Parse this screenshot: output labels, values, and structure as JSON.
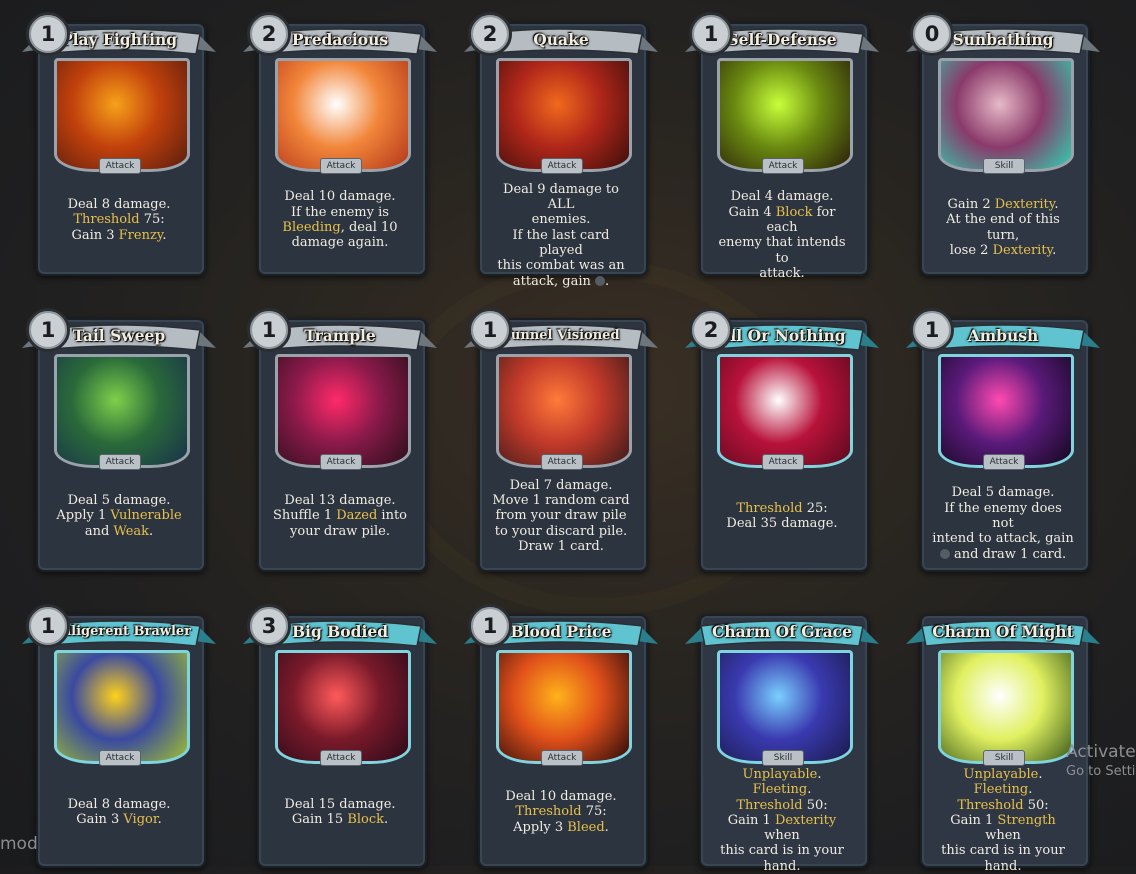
{
  "cards": [
    {
      "cost": "1",
      "title": "Play Fighting",
      "type": "Attack",
      "style": "grey",
      "lines": [
        [
          "Deal 8 damage."
        ],
        [
          {
            "k": "Threshold"
          },
          " 75:"
        ],
        [
          "Gain 3 ",
          {
            "k": "Frenzy"
          },
          "."
        ]
      ],
      "art": [
        "#f7a11a",
        "#c2410c",
        "#5a1d0e"
      ]
    },
    {
      "cost": "2",
      "title": "Predacious",
      "type": "Attack",
      "style": "grey",
      "lines": [
        [
          "Deal 10 damage."
        ],
        [
          "If the enemy is"
        ],
        [
          {
            "k": "Bleeding"
          },
          ", deal 10"
        ],
        [
          "damage again."
        ]
      ],
      "art": [
        "#ffffff",
        "#f2863a",
        "#b3361a"
      ]
    },
    {
      "cost": "2",
      "title": "Quake",
      "type": "Attack",
      "style": "grey",
      "lines": [
        [
          "Deal 9 damage to ALL"
        ],
        [
          "enemies."
        ],
        [
          "If the last card played"
        ],
        [
          "this combat was an"
        ],
        [
          "attack, gain ",
          {
            "orb": true
          },
          "."
        ]
      ],
      "art": [
        "#f06a1c",
        "#b0261a",
        "#3a0f0a"
      ]
    },
    {
      "cost": "1",
      "title": "Self-Defense",
      "type": "Attack",
      "style": "grey",
      "lines": [
        [
          "Deal 4 damage."
        ],
        [
          "Gain 4 ",
          {
            "k": "Block"
          },
          " for each"
        ],
        [
          "enemy that intends to"
        ],
        [
          "attack."
        ]
      ],
      "art": [
        "#c8ff3a",
        "#6a8a10",
        "#2a1d0a"
      ]
    },
    {
      "cost": "0",
      "title": "Sunbathing",
      "type": "Skill",
      "style": "grey",
      "lines": [
        [
          "Gain 2 ",
          {
            "k": "Dexterity"
          },
          "."
        ],
        [
          "At the end of this turn,"
        ],
        [
          "lose 2 ",
          {
            "k": "Dexterity"
          },
          "."
        ]
      ],
      "art": [
        "#e7b9c8",
        "#8a3a6a",
        "#2fd1b0"
      ]
    },
    {
      "cost": "1",
      "title": "Tail Sweep",
      "type": "Attack",
      "style": "grey",
      "lines": [
        [
          "Deal 5 damage."
        ],
        [
          "Apply 1 ",
          {
            "k": "Vulnerable"
          }
        ],
        [
          "and ",
          {
            "k": "Weak"
          },
          "."
        ]
      ],
      "art": [
        "#7fd04a",
        "#2a6a3a",
        "#18324a"
      ]
    },
    {
      "cost": "1",
      "title": "Trample",
      "type": "Attack",
      "style": "grey",
      "lines": [
        [
          "Deal 13 damage."
        ],
        [
          "Shuffle 1 ",
          {
            "k": "Dazed"
          },
          " into"
        ],
        [
          "your draw pile."
        ]
      ],
      "art": [
        "#ff2a6a",
        "#8a1a4a",
        "#2a0f1a"
      ]
    },
    {
      "cost": "1",
      "title": "Tunnel Visioned",
      "type": "Attack",
      "style": "grey",
      "lines": [
        [
          "Deal 7 damage."
        ],
        [
          "Move 1 random card"
        ],
        [
          "from your draw pile"
        ],
        [
          "to your discard pile."
        ],
        [
          "Draw 1 card."
        ]
      ],
      "art": [
        "#ff7a3a",
        "#c23a2a",
        "#3a1a1a"
      ]
    },
    {
      "cost": "2",
      "title": "All Or Nothing",
      "type": "Attack",
      "style": "teal",
      "lines": [
        [
          {
            "k": "Threshold"
          },
          " 25:"
        ],
        [
          "Deal 35 damage."
        ]
      ],
      "art": [
        "#ffffff",
        "#b8123a",
        "#5a0a1e"
      ]
    },
    {
      "cost": "1",
      "title": "Ambush",
      "type": "Attack",
      "style": "teal",
      "lines": [
        [
          "Deal 5 damage."
        ],
        [
          "If the enemy does not"
        ],
        [
          "intend to attack, gain"
        ],
        [
          {
            "orb": true
          },
          " and draw 1 card."
        ]
      ],
      "art": [
        "#ff4ab0",
        "#5a1a7a",
        "#12081e"
      ]
    },
    {
      "cost": "1",
      "title": "Belligerent Brawler",
      "type": "Attack",
      "style": "teal",
      "lines": [
        [
          "Deal 8 damage."
        ],
        [
          "Gain 3 ",
          {
            "k": "Vigor"
          },
          "."
        ]
      ],
      "art": [
        "#ffd21a",
        "#3a4aa0",
        "#a0c030"
      ]
    },
    {
      "cost": "3",
      "title": "Big Bodied",
      "type": "Attack",
      "style": "teal",
      "lines": [
        [
          "Deal 15 damage."
        ],
        [
          "Gain 15 ",
          {
            "k": "Block"
          },
          "."
        ]
      ],
      "art": [
        "#ff5a5a",
        "#7a1a2a",
        "#2a0a1a"
      ]
    },
    {
      "cost": "1",
      "title": "Blood Price",
      "type": "Attack",
      "style": "teal",
      "lines": [
        [
          "Deal 10 damage."
        ],
        [
          {
            "k": "Threshold"
          },
          " 75:"
        ],
        [
          "Apply 3 ",
          {
            "k": "Bleed"
          },
          "."
        ]
      ],
      "art": [
        "#ffb21a",
        "#e0501a",
        "#2a0a0a"
      ]
    },
    {
      "cost": "",
      "title": "Charm Of Grace",
      "type": "Skill",
      "style": "teal",
      "lines": [
        [
          {
            "k": "Unplayable"
          },
          "."
        ],
        [
          {
            "k": "Fleeting"
          },
          "."
        ],
        [
          {
            "k": "Threshold"
          },
          " 50:"
        ],
        [
          "Gain 1 ",
          {
            "k": "Dexterity"
          },
          " when"
        ],
        [
          "this card is in your"
        ],
        [
          "hand."
        ]
      ],
      "art": [
        "#7ad0ff",
        "#3a3ab0",
        "#1a1a4a"
      ]
    },
    {
      "cost": "",
      "title": "Charm Of Might",
      "type": "Skill",
      "style": "teal",
      "lines": [
        [
          {
            "k": "Unplayable"
          },
          "."
        ],
        [
          {
            "k": "Fleeting"
          },
          "."
        ],
        [
          {
            "k": "Threshold"
          },
          " 50:"
        ],
        [
          "Gain 1 ",
          {
            "k": "Strength"
          },
          " when"
        ],
        [
          "this card is in your"
        ],
        [
          "hand."
        ]
      ],
      "art": [
        "#ffffff",
        "#e0f060",
        "#3a5a1a"
      ]
    }
  ],
  "watermark": {
    "line1": "Activate",
    "line2": "Go to Setti"
  },
  "corner_text": "mod"
}
